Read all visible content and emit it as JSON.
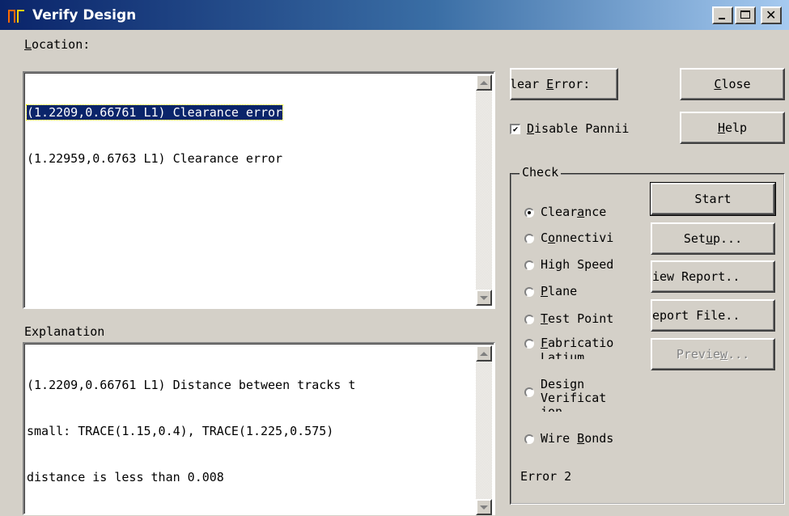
{
  "window": {
    "title": "Verify Design"
  },
  "location": {
    "label_u": "L",
    "label_rest": "ocation:",
    "items": [
      "(1.2209,0.66761 L1) Clearance error",
      "(1.22959,0.6763 L1) Clearance error"
    ],
    "selected_index": 0
  },
  "explanation": {
    "label": "Explanation",
    "lines": [
      "(1.2209,0.66761 L1) Distance between tracks t",
      "small: TRACE(1.15,0.4), TRACE(1.225,0.575)",
      "distance is less than 0.008"
    ]
  },
  "buttons": {
    "clear_errors": {
      "a": "lear ",
      "u": "E",
      "b": "rror:"
    },
    "close": {
      "u": "C",
      "b": "lose"
    },
    "help": {
      "u": "H",
      "b": "elp"
    },
    "start": "Start",
    "setup": {
      "a": "Set",
      "u": "u",
      "b": "p..."
    },
    "view_report": "iew Report..",
    "report_file": "eport File..",
    "preview": {
      "a": "Previe",
      "u": "w",
      "b": "..."
    }
  },
  "disable_panning": {
    "u": "D",
    "b": "isable Pannii",
    "checked": true
  },
  "check_group": {
    "label": "Check",
    "options": [
      {
        "a": "Clear",
        "u": "a",
        "b": "nce",
        "checked": true
      },
      {
        "a": "C",
        "u": "o",
        "b": "nnectivi",
        "checked": false
      },
      {
        "a": "High Speed",
        "u": "",
        "b": "",
        "checked": false
      },
      {
        "a": "",
        "u": "P",
        "b": "lane",
        "checked": false
      },
      {
        "a": "",
        "u": "T",
        "b": "est Point",
        "checked": false
      },
      {
        "a": "",
        "u": "F",
        "b": "abricatio",
        "extra": "Latium",
        "checked": false
      },
      {
        "a": "Design",
        "u": "",
        "b": "",
        "extra": "Verificat",
        "extra2": "ion",
        "checked": false
      },
      {
        "a": "Wire ",
        "u": "B",
        "b": "onds",
        "checked": false
      }
    ]
  },
  "status": {
    "error_text": "Error 2"
  }
}
